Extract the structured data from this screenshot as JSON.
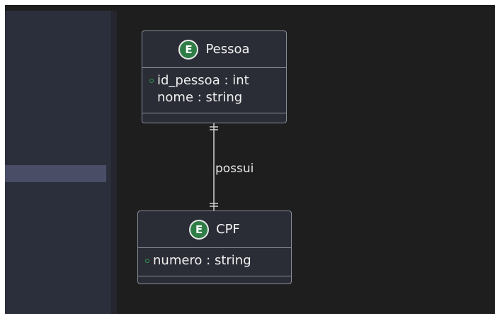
{
  "entities": [
    {
      "badge": "E",
      "name": "Pessoa",
      "attributes": [
        {
          "key": true,
          "text": "id_pessoa : int"
        },
        {
          "key": false,
          "text": "nome : string"
        }
      ]
    },
    {
      "badge": "E",
      "name": "CPF",
      "attributes": [
        {
          "key": true,
          "text": "numero : string"
        }
      ]
    }
  ],
  "relationship": {
    "label": "possui",
    "from": "Pessoa",
    "to": "CPF",
    "from_cardinality": "exactly-one",
    "to_cardinality": "exactly-one"
  },
  "colors": {
    "canvas": "#1e1e1e",
    "entity_fill": "#2b2d36",
    "entity_border": "#8a8d99",
    "badge_fill": "#2e7d46",
    "key_marker": "#2e9a52",
    "sidebar": "#2b2e3b",
    "sidebar_selected": "#4a4d66"
  }
}
